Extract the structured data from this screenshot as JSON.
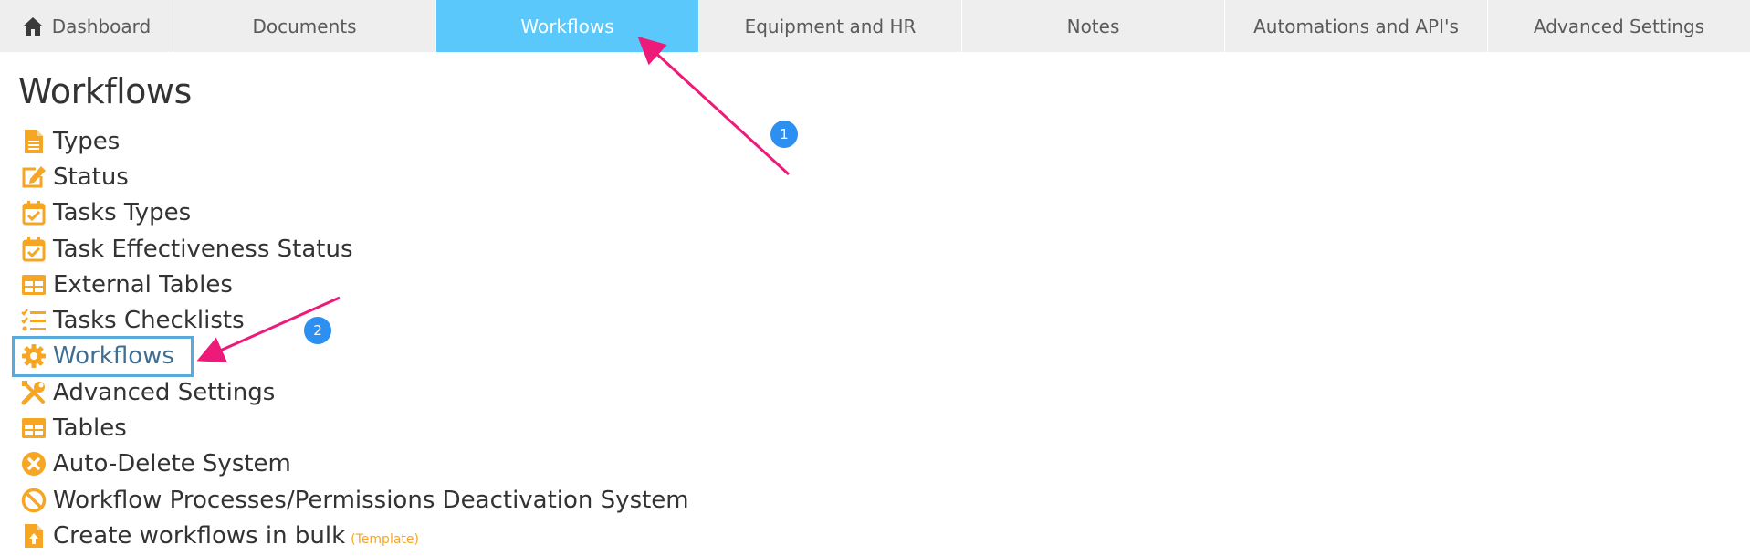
{
  "tabs": [
    {
      "label": "Dashboard",
      "icon": "home-icon",
      "active": false
    },
    {
      "label": "Documents",
      "active": false
    },
    {
      "label": "Workflows",
      "active": true
    },
    {
      "label": "Equipment and HR",
      "active": false
    },
    {
      "label": "Notes",
      "active": false
    },
    {
      "label": "Automations and API's",
      "active": false
    },
    {
      "label": "Advanced Settings",
      "active": false
    }
  ],
  "page": {
    "title": "Workflows"
  },
  "menu": [
    {
      "label": "Types",
      "icon": "document-icon"
    },
    {
      "label": "Status",
      "icon": "edit-icon"
    },
    {
      "label": "Tasks Types",
      "icon": "calendar-check-icon"
    },
    {
      "label": "Task Effectiveness Status",
      "icon": "calendar-check-icon"
    },
    {
      "label": "External Tables",
      "icon": "table-icon"
    },
    {
      "label": "Tasks Checklists",
      "icon": "checklist-icon"
    },
    {
      "label": "Workflows",
      "icon": "gear-icon",
      "selected": true
    },
    {
      "label": "Advanced Settings",
      "icon": "tools-icon"
    },
    {
      "label": "Tables",
      "icon": "table-icon"
    },
    {
      "label": "Auto-Delete System",
      "icon": "close-circle-icon"
    },
    {
      "label": "Workflow Processes/Permissions Deactivation System",
      "icon": "ban-icon"
    },
    {
      "label": "Create workflows in bulk",
      "icon": "file-upload-icon",
      "extra_link": "(Template)"
    }
  ],
  "annotations": [
    {
      "number": "1"
    },
    {
      "number": "2"
    }
  ],
  "colors": {
    "tab_bar": "#eeeeee",
    "tab_active": "#5ac8fa",
    "icon_orange": "#f6a623",
    "annotation_arrow": "#ee1a7a",
    "annotation_badge": "#2d8ff0",
    "selected_border": "#58a9dc"
  }
}
